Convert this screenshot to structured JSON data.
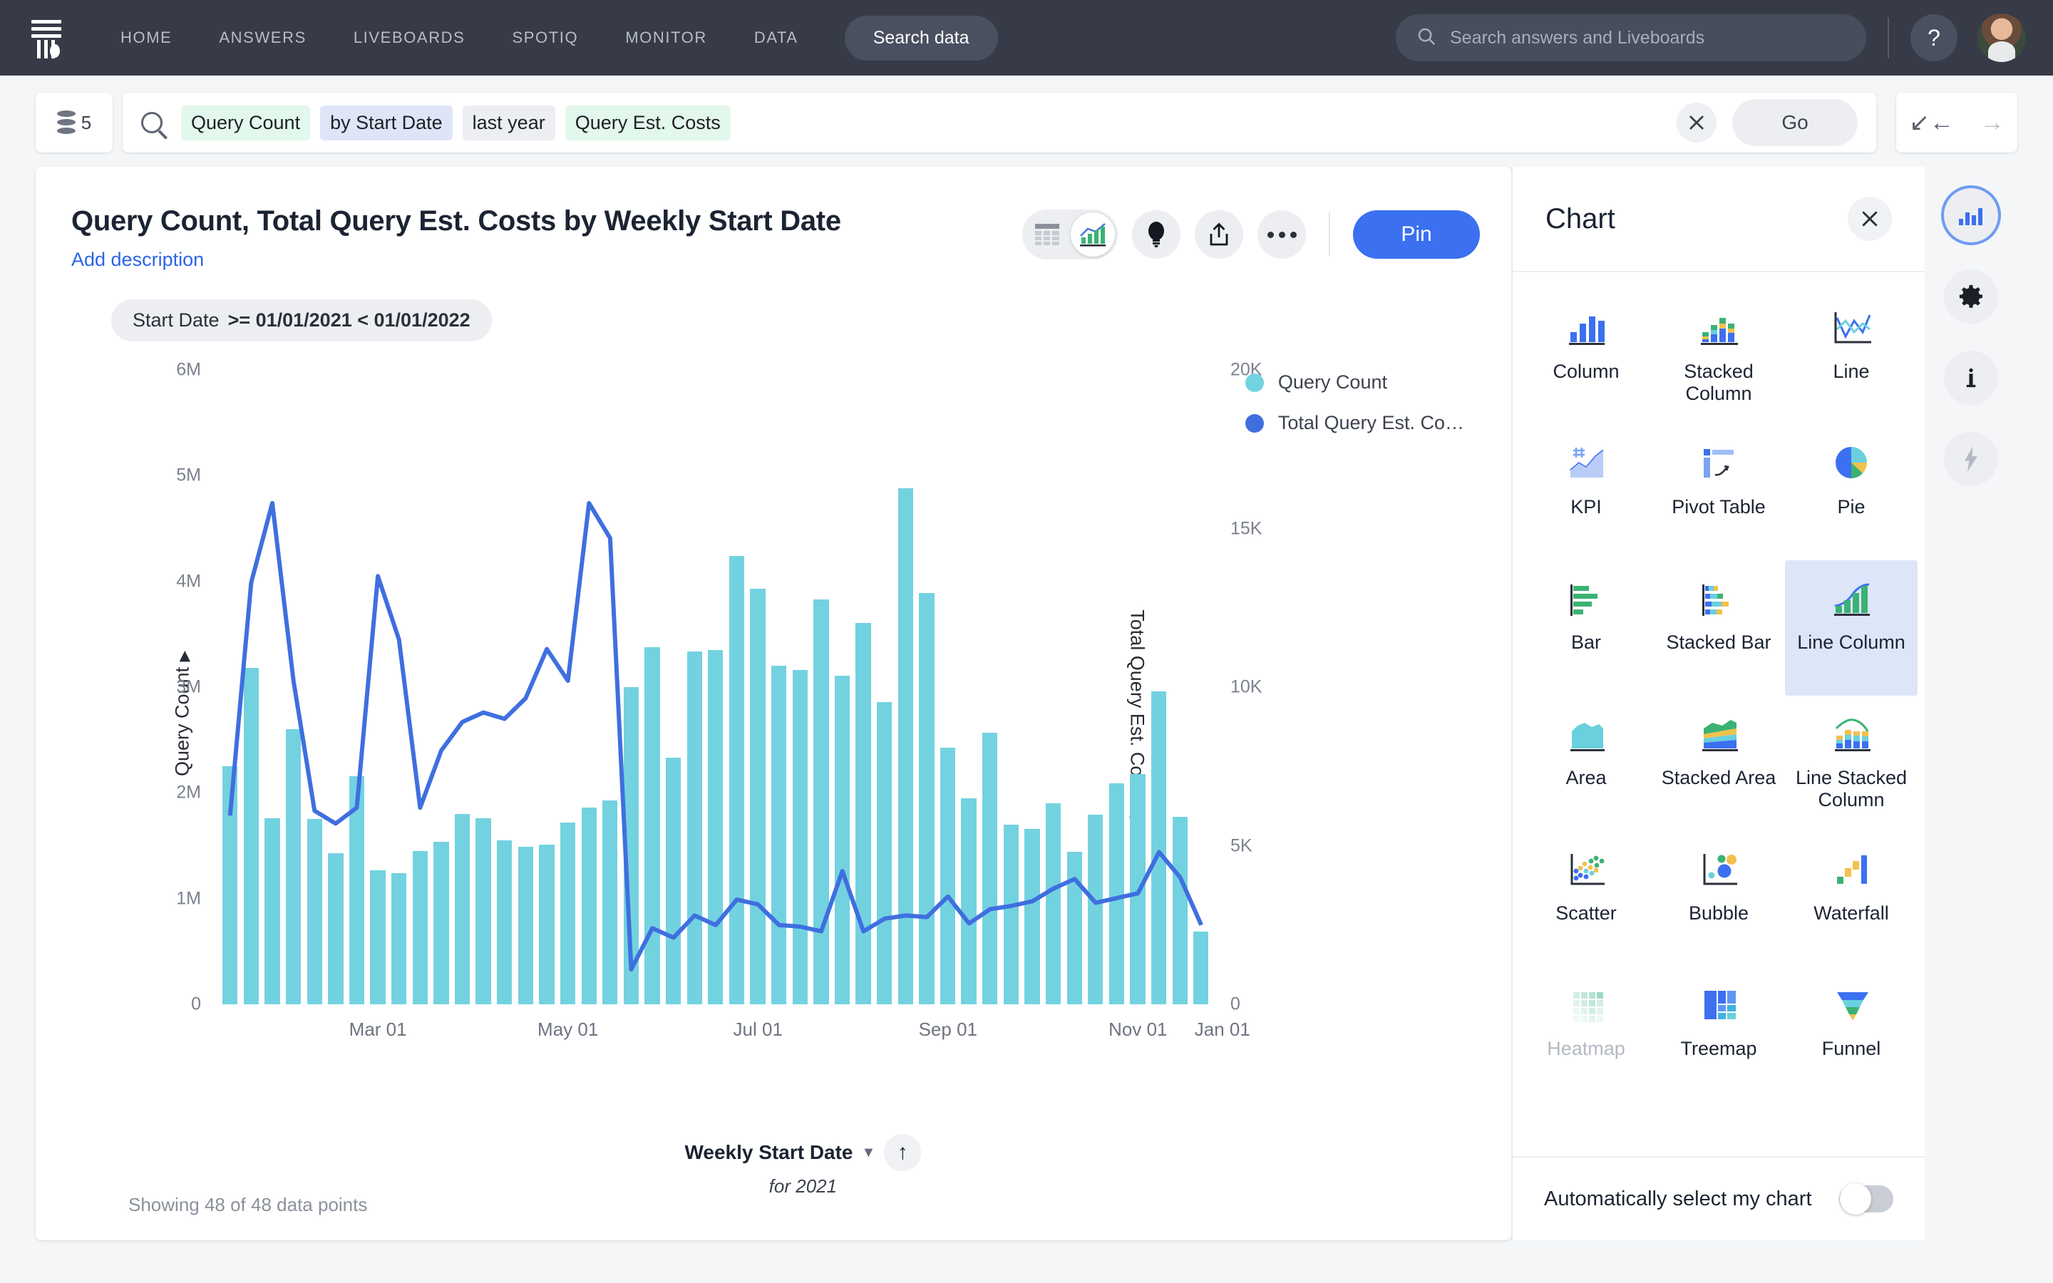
{
  "nav": {
    "logo_icon": "thoughtspot-logo-icon",
    "links": [
      "HOME",
      "ANSWERS",
      "LIVEBOARDS",
      "SPOTIQ",
      "MONITOR",
      "DATA"
    ],
    "search_data_label": "Search data",
    "global_search_placeholder": "Search answers and Liveboards",
    "global_search_value": "",
    "search_icon": "search-icon",
    "help_label": "?",
    "avatar_icon": "user-avatar"
  },
  "searchrow": {
    "source_count": "5",
    "source_icon": "data-stack-icon",
    "search_icon": "search-icon",
    "tokens": [
      {
        "label": "Query Count",
        "kind": "measure"
      },
      {
        "label": "by Start Date",
        "kind": "attribute"
      },
      {
        "label": "last year",
        "kind": "filter"
      },
      {
        "label": "Query Est. Costs",
        "kind": "measure"
      }
    ],
    "clear_icon": "close-icon",
    "go_label": "Go",
    "undo_icon": "undo-arrow-icon",
    "redo_icon": "redo-arrow-icon"
  },
  "answer": {
    "title": "Query Count, Total Query Est. Costs by Weekly Start Date",
    "add_description": "Add description",
    "toolbar": {
      "table_icon": "table-view-icon",
      "chart_icon": "chart-view-icon",
      "insight_icon": "lightbulb-icon",
      "share_icon": "share-upload-icon",
      "more_icon": "more-horizontal-icon",
      "pin_label": "Pin"
    },
    "filter_chip": {
      "field": "Start Date",
      "value": ">= 01/01/2021 < 01/01/2022"
    },
    "footer_note": "Showing 48 of 48 data points",
    "xaxis_control": {
      "name": "Weekly Start Date",
      "caret_icon": "chevron-down-icon",
      "sort_icon": "sort-ascending-icon",
      "subtitle": "for 2021"
    }
  },
  "chart_data": {
    "type": "bar",
    "title": "Query Count, Total Query Est. Costs by Weekly Start Date",
    "xlabel": "Weekly Start Date",
    "ylabel": "Query Count",
    "y2label": "Total Query Est. Costs",
    "ylim": [
      0,
      6000000
    ],
    "y2lim": [
      0,
      20000
    ],
    "yticks": [
      "0",
      "1M",
      "2M",
      "3M",
      "4M",
      "5M",
      "6M"
    ],
    "ytick_values": [
      0,
      1000000,
      2000000,
      3000000,
      4000000,
      5000000,
      6000000
    ],
    "y2ticks": [
      "0",
      "5K",
      "10K",
      "15K",
      "20K"
    ],
    "y2tick_values": [
      0,
      5000,
      10000,
      15000,
      20000
    ],
    "xticks": [
      "Mar 01",
      "May 01",
      "Jul 01",
      "Sep 01",
      "Nov 01",
      "Jan 01"
    ],
    "xtick_index": [
      7,
      16,
      25,
      34,
      43,
      47
    ],
    "grid": false,
    "legend_position": "right",
    "colors": {
      "bar": "#73d2e0",
      "line": "#3f6fdf"
    },
    "series": [
      {
        "name": "Query Count",
        "type": "bar",
        "axis": "left",
        "color": "#73d2e0",
        "values": [
          2250000,
          3180000,
          1760000,
          2600000,
          1750000,
          1430000,
          2160000,
          1270000,
          1240000,
          1450000,
          1540000,
          1800000,
          1760000,
          1550000,
          1490000,
          1510000,
          1720000,
          1860000,
          1930000,
          3000000,
          3380000,
          2330000,
          3340000,
          3350000,
          4240000,
          3930000,
          3200000,
          3160000,
          3830000,
          3110000,
          3610000,
          2860000,
          4880000,
          3890000,
          2430000,
          1950000,
          2570000,
          1700000,
          1660000,
          1900000,
          1440000,
          1790000,
          2090000,
          2180000,
          2960000,
          1770000,
          690000
        ]
      },
      {
        "name": "Total Query Est. Costs",
        "type": "line",
        "axis": "right",
        "color": "#3f6fdf",
        "values": [
          5950,
          13300,
          15800,
          10200,
          6100,
          5700,
          6200,
          13500,
          11500,
          6200,
          8000,
          8900,
          9200,
          9000,
          9650,
          11200,
          10200,
          15800,
          14700,
          1100,
          2400,
          2100,
          2800,
          2500,
          3300,
          3150,
          2500,
          2450,
          2300,
          4200,
          2300,
          2700,
          2800,
          2750,
          3400,
          2550,
          3000,
          3100,
          3250,
          3650,
          3950,
          3200,
          3350,
          3500,
          4800,
          4000,
          2500
        ]
      }
    ],
    "legend": [
      {
        "label": "Query Count",
        "color": "#73d2e0"
      },
      {
        "label": "Total Query Est. Co…",
        "color": "#3f6fdf"
      }
    ],
    "data_point_count": 48
  },
  "chart_panel": {
    "title": "Chart",
    "close_icon": "close-icon",
    "types": [
      {
        "label": "Column",
        "icon": "column-chart-icon",
        "selected": false,
        "disabled": false
      },
      {
        "label": "Stacked Column",
        "icon": "stacked-column-chart-icon",
        "selected": false,
        "disabled": false
      },
      {
        "label": "Line",
        "icon": "line-chart-icon",
        "selected": false,
        "disabled": false
      },
      {
        "label": "KPI",
        "icon": "kpi-icon",
        "selected": false,
        "disabled": false
      },
      {
        "label": "Pivot Table",
        "icon": "pivot-table-icon",
        "selected": false,
        "disabled": false
      },
      {
        "label": "Pie",
        "icon": "pie-chart-icon",
        "selected": false,
        "disabled": false
      },
      {
        "label": "Bar",
        "icon": "bar-chart-icon",
        "selected": false,
        "disabled": false
      },
      {
        "label": "Stacked Bar",
        "icon": "stacked-bar-chart-icon",
        "selected": false,
        "disabled": false
      },
      {
        "label": "Line Column",
        "icon": "line-column-chart-icon",
        "selected": true,
        "disabled": false
      },
      {
        "label": "Area",
        "icon": "area-chart-icon",
        "selected": false,
        "disabled": false
      },
      {
        "label": "Stacked Area",
        "icon": "stacked-area-chart-icon",
        "selected": false,
        "disabled": false
      },
      {
        "label": "Line Stacked Column",
        "icon": "line-stacked-column-chart-icon",
        "selected": false,
        "disabled": false
      },
      {
        "label": "Scatter",
        "icon": "scatter-chart-icon",
        "selected": false,
        "disabled": false
      },
      {
        "label": "Bubble",
        "icon": "bubble-chart-icon",
        "selected": false,
        "disabled": false
      },
      {
        "label": "Waterfall",
        "icon": "waterfall-chart-icon",
        "selected": false,
        "disabled": false
      },
      {
        "label": "Heatmap",
        "icon": "heatmap-chart-icon",
        "selected": false,
        "disabled": true
      },
      {
        "label": "Treemap",
        "icon": "treemap-chart-icon",
        "selected": false,
        "disabled": false
      },
      {
        "label": "Funnel",
        "icon": "funnel-chart-icon",
        "selected": false,
        "disabled": false
      }
    ],
    "auto_select_label": "Automatically select my chart",
    "auto_select_on": false
  },
  "rail": [
    {
      "icon": "chart-config-icon",
      "active": true,
      "disabled": false
    },
    {
      "icon": "gear-icon",
      "active": false,
      "disabled": false
    },
    {
      "icon": "info-icon",
      "active": false,
      "disabled": false
    },
    {
      "icon": "lightning-icon",
      "active": false,
      "disabled": true
    }
  ]
}
